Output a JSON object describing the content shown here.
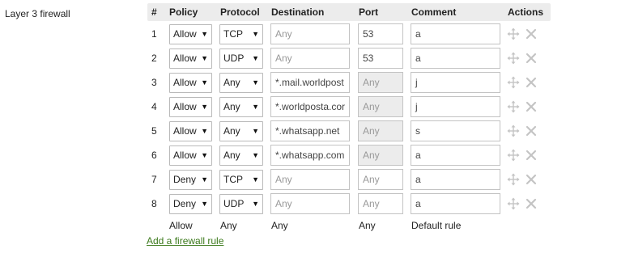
{
  "section_label": "Layer 3 firewall",
  "headers": {
    "index": "#",
    "policy": "Policy",
    "protocol": "Protocol",
    "destination": "Destination",
    "port": "Port",
    "comment": "Comment",
    "actions": "Actions"
  },
  "rows": [
    {
      "index": "1",
      "policy": "Allow",
      "protocol": "TCP",
      "destination": "",
      "destination_placeholder": "Any",
      "port": "53",
      "port_placeholder": "",
      "port_disabled": false,
      "comment": "a"
    },
    {
      "index": "2",
      "policy": "Allow",
      "protocol": "UDP",
      "destination": "",
      "destination_placeholder": "Any",
      "port": "53",
      "port_placeholder": "",
      "port_disabled": false,
      "comment": "a"
    },
    {
      "index": "3",
      "policy": "Allow",
      "protocol": "Any",
      "destination": "*.mail.worldpost",
      "destination_placeholder": "",
      "port": "",
      "port_placeholder": "Any",
      "port_disabled": true,
      "comment": "j"
    },
    {
      "index": "4",
      "policy": "Allow",
      "protocol": "Any",
      "destination": "*.worldposta.cor",
      "destination_placeholder": "",
      "port": "",
      "port_placeholder": "Any",
      "port_disabled": true,
      "comment": "j"
    },
    {
      "index": "5",
      "policy": "Allow",
      "protocol": "Any",
      "destination": "*.whatsapp.net",
      "destination_placeholder": "",
      "port": "",
      "port_placeholder": "Any",
      "port_disabled": true,
      "comment": "s"
    },
    {
      "index": "6",
      "policy": "Allow",
      "protocol": "Any",
      "destination": "*.whatsapp.com",
      "destination_placeholder": "",
      "port": "",
      "port_placeholder": "Any",
      "port_disabled": true,
      "comment": "a"
    },
    {
      "index": "7",
      "policy": "Deny",
      "protocol": "TCP",
      "destination": "",
      "destination_placeholder": "Any",
      "port": "",
      "port_placeholder": "Any",
      "port_disabled": false,
      "comment": "a"
    },
    {
      "index": "8",
      "policy": "Deny",
      "protocol": "UDP",
      "destination": "",
      "destination_placeholder": "Any",
      "port": "",
      "port_placeholder": "Any",
      "port_disabled": false,
      "comment": "a"
    }
  ],
  "default_rule": {
    "policy": "Allow",
    "protocol": "Any",
    "destination": "Any",
    "port": "Any",
    "comment": "Default rule"
  },
  "add_rule_link": "Add a firewall rule",
  "icons": {
    "move": "move-icon",
    "delete": "close-icon"
  },
  "colors": {
    "link": "#3c7a1c",
    "header_bg": "#ececec",
    "disabled_bg": "#ececec"
  }
}
